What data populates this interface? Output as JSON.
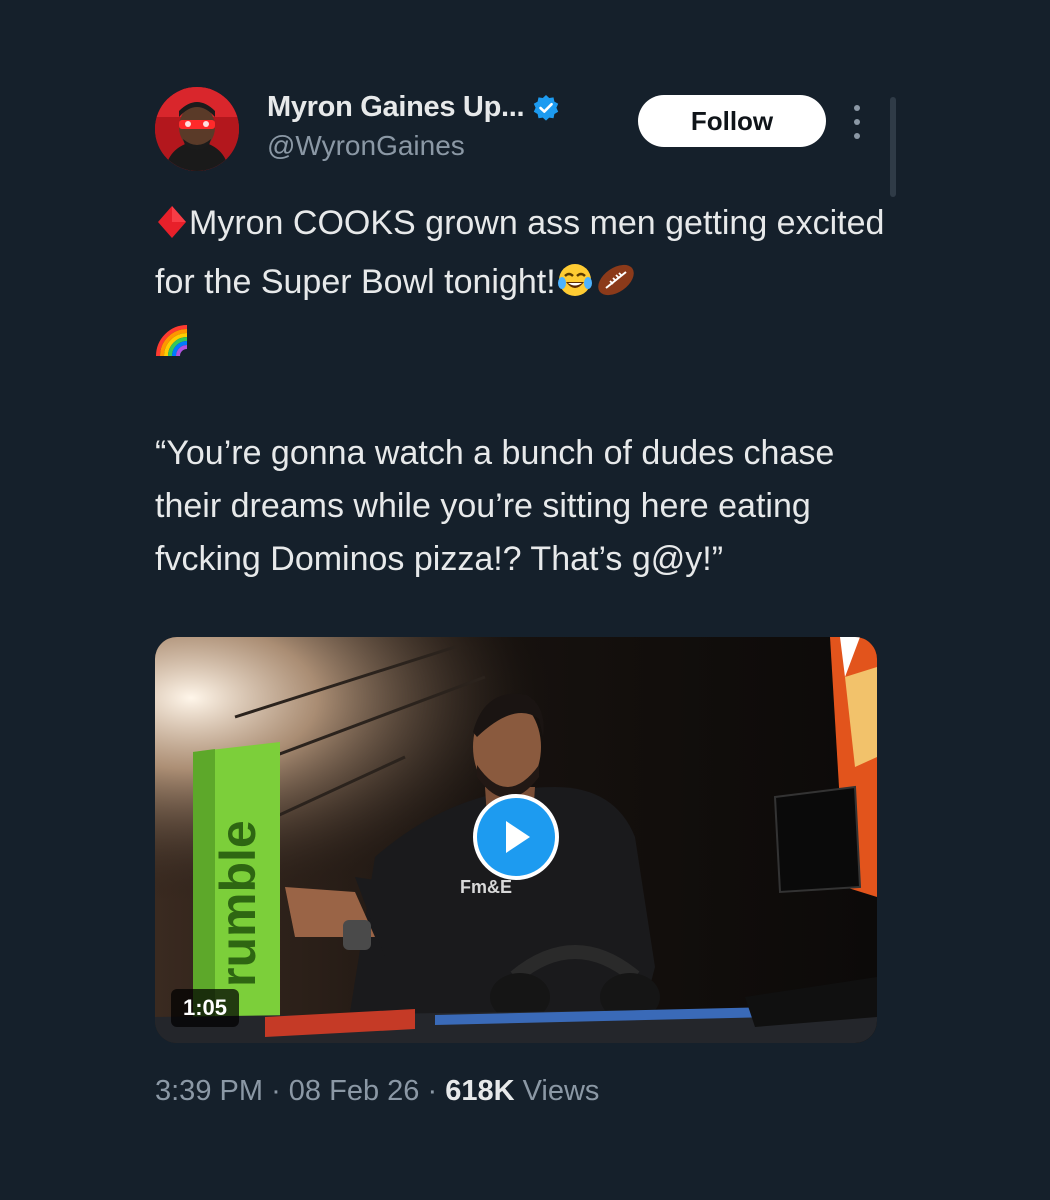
{
  "author": {
    "display_name": "Myron Gaines Up...",
    "handle": "@WyronGaines",
    "verified": true
  },
  "follow_label": "Follow",
  "tweet": {
    "line1": "Myron COOKS grown ass men getting excited for the Super Bowl tonight!",
    "quote": "“You’re gonna watch a bunch of dudes chase their dreams while you’re sitting here eating fvcking Dominos pizza!? That’s g@y!”",
    "emojis": [
      "red-diamond-icon",
      "tears-of-joy-icon",
      "football-icon",
      "rainbow-icon"
    ]
  },
  "video": {
    "duration": "1:05",
    "sign_text": "rumble",
    "shirt_text": "Fm&E"
  },
  "meta": {
    "time": "3:39 PM",
    "separator": "·",
    "date": "08 Feb 26",
    "views_count": "618K",
    "views_label": "Views"
  },
  "colors": {
    "background": "#15202b",
    "text": "#e7e9ea",
    "secondary_text": "#8b98a5",
    "accent": "#1d9bf0"
  }
}
